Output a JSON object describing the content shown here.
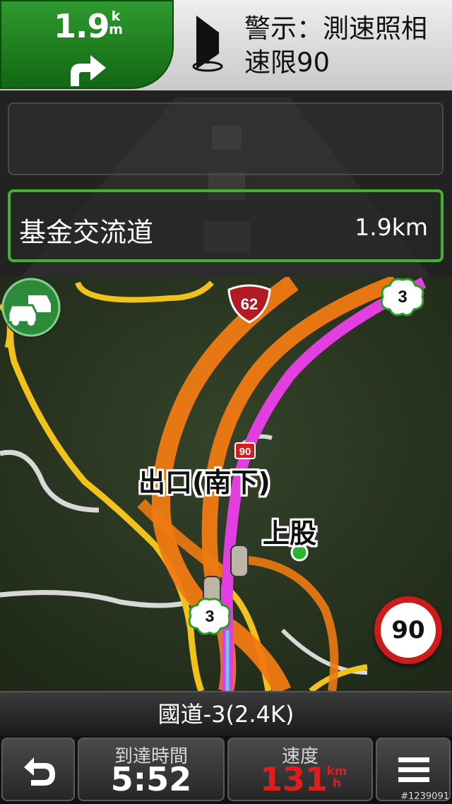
{
  "maneuver": {
    "distance": "1.9",
    "unit_top": "k",
    "unit_bottom": "m"
  },
  "alert": {
    "title": "警示：測速照相",
    "limit": "速限90"
  },
  "exit_panel": {
    "name": "基金交流道",
    "distance": "1.9km"
  },
  "map": {
    "route_shields": [
      "62",
      "3",
      "3",
      "90"
    ],
    "labels": {
      "exit": "出口(南下)",
      "town": "上股"
    },
    "speed_limit": "90",
    "colors": {
      "route": "#e23ee0",
      "highway": "#f07a12",
      "road_yellow": "#f0c21a",
      "road_white": "#d8d8d8",
      "terrain": "#26311c"
    }
  },
  "side_buttons": {
    "detour": "detour-icon",
    "cancel": "cancel-route-icon",
    "traffic": "traffic-icon"
  },
  "road_bar": {
    "name": "國道-3(2.4K)"
  },
  "bottom": {
    "eta_label": "到達時間",
    "eta_value": "5:52",
    "speed_label": "速度",
    "speed_value": "131",
    "speed_unit_top": "km",
    "speed_unit_bottom": "h"
  },
  "watermark": "#1239091"
}
